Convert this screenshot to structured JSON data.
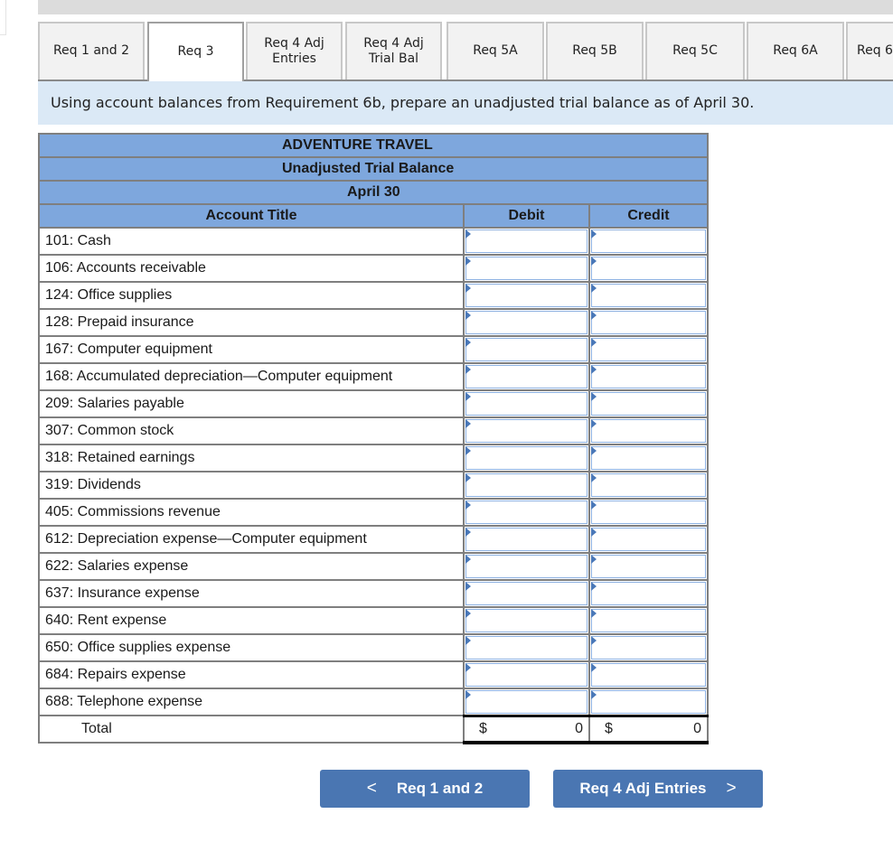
{
  "tabs": [
    {
      "label": "Req 1 and 2",
      "active": false
    },
    {
      "label": "Req 3",
      "active": true
    },
    {
      "label": "Req 4 Adj\nEntries",
      "active": false
    },
    {
      "label": "Req 4 Adj\nTrial Bal",
      "active": false
    },
    {
      "label": "Req 5A",
      "active": false
    },
    {
      "label": "Req 5B",
      "active": false
    },
    {
      "label": "Req 5C",
      "active": false
    },
    {
      "label": "Req 6A",
      "active": false
    },
    {
      "label": "Req 6",
      "active": false
    }
  ],
  "instruction": "Using account balances from Requirement 6b, prepare an unadjusted trial balance as of April 30.",
  "trial_balance": {
    "company": "ADVENTURE TRAVEL",
    "title": "Unadjusted Trial Balance",
    "date": "April 30",
    "columns": {
      "account": "Account Title",
      "debit": "Debit",
      "credit": "Credit"
    },
    "accounts": [
      {
        "title": "101: Cash",
        "debit": "",
        "credit": ""
      },
      {
        "title": "106: Accounts receivable",
        "debit": "",
        "credit": ""
      },
      {
        "title": "124: Office supplies",
        "debit": "",
        "credit": ""
      },
      {
        "title": "128: Prepaid insurance",
        "debit": "",
        "credit": ""
      },
      {
        "title": "167: Computer equipment",
        "debit": "",
        "credit": ""
      },
      {
        "title": "168: Accumulated depreciation—Computer equipment",
        "debit": "",
        "credit": ""
      },
      {
        "title": "209: Salaries payable",
        "debit": "",
        "credit": ""
      },
      {
        "title": "307: Common stock",
        "debit": "",
        "credit": ""
      },
      {
        "title": "318: Retained earnings",
        "debit": "",
        "credit": ""
      },
      {
        "title": "319: Dividends",
        "debit": "",
        "credit": ""
      },
      {
        "title": "405: Commissions revenue",
        "debit": "",
        "credit": ""
      },
      {
        "title": "612: Depreciation expense—Computer equipment",
        "debit": "",
        "credit": ""
      },
      {
        "title": "622: Salaries expense",
        "debit": "",
        "credit": ""
      },
      {
        "title": "637: Insurance expense",
        "debit": "",
        "credit": ""
      },
      {
        "title": "640: Rent expense",
        "debit": "",
        "credit": ""
      },
      {
        "title": "650: Office supplies expense",
        "debit": "",
        "credit": ""
      },
      {
        "title": "684: Repairs expense",
        "debit": "",
        "credit": ""
      },
      {
        "title": "688: Telephone expense",
        "debit": "",
        "credit": ""
      }
    ],
    "total": {
      "label": "Total",
      "currency": "$",
      "debit": "0",
      "credit": "0"
    }
  },
  "nav": {
    "prev_label": "Req 1 and 2",
    "prev_icon": "<",
    "next_label": "Req 4 Adj Entries",
    "next_icon": ">"
  }
}
